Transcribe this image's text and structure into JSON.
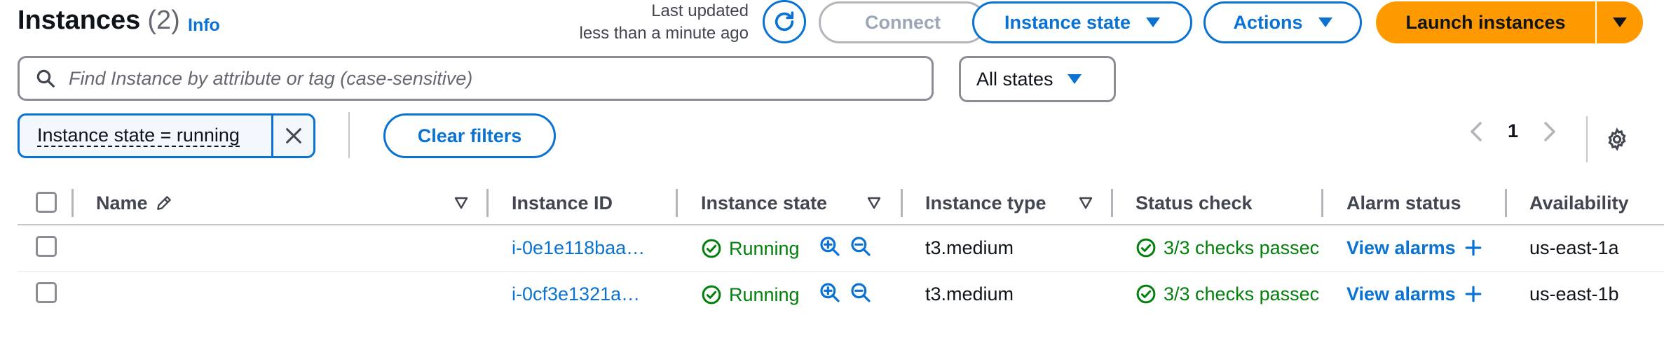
{
  "header": {
    "title": "Instances",
    "count": "(2)",
    "info": "Info",
    "last_updated_line1": "Last updated",
    "last_updated_line2": "less than a minute ago",
    "connect_label": "Connect",
    "instance_state_label": "Instance state",
    "actions_label": "Actions",
    "launch_label": "Launch instances"
  },
  "filters": {
    "search_placeholder": "Find Instance by attribute or tag (case-sensitive)",
    "states_select": "All states",
    "token": "Instance state = running",
    "clear_label": "Clear filters"
  },
  "pagination": {
    "page": "1"
  },
  "table": {
    "columns": [
      "Name",
      "Instance ID",
      "Instance state",
      "Instance type",
      "Status check",
      "Alarm status",
      "Availability"
    ],
    "rows": [
      {
        "name": "",
        "instance_id": "i-0e1e118baa…",
        "state": "Running",
        "type": "t3.medium",
        "status_check": "3/3 checks passec",
        "alarm": "View alarms",
        "az": "us-east-1a"
      },
      {
        "name": "",
        "instance_id": "i-0cf3e1321a…",
        "state": "Running",
        "type": "t3.medium",
        "status_check": "3/3 checks passec",
        "alarm": "View alarms",
        "az": "us-east-1b"
      }
    ]
  },
  "colors": {
    "link_blue": "#0972d3",
    "launch_orange": "#ff9900",
    "success_green": "#037f0c"
  },
  "icons": [
    "refresh-icon",
    "caret-down-icon",
    "search-icon",
    "close-icon",
    "chevron-left-icon",
    "chevron-right-icon",
    "gear-icon",
    "pencil-icon",
    "sort-icon",
    "status-positive-icon",
    "zoom-in-icon",
    "zoom-out-icon",
    "plus-icon"
  ]
}
